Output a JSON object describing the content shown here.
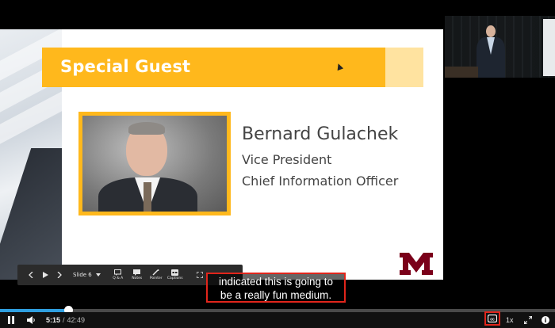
{
  "slide": {
    "banner_title": "Special Guest",
    "guest_name": "Bernard Gulachek",
    "guest_role_1": "Vice President",
    "guest_role_2": "Chief Information Officer",
    "logo_text": "M",
    "accent_color": "#ffb81c",
    "logo_color": "#7a0019"
  },
  "slide_toolbar": {
    "slide_label": "Slide 6",
    "tools": [
      {
        "icon": "qa-icon",
        "label": "Q & A"
      },
      {
        "icon": "notes-icon",
        "label": "Notes"
      },
      {
        "icon": "pointer-icon",
        "label": "Pointer"
      },
      {
        "icon": "captions-icon",
        "label": "Captions"
      }
    ]
  },
  "captions": {
    "line1": "indicated this is going to",
    "line2": "be a really fun medium.",
    "highlight_color": "#e1251b"
  },
  "player": {
    "current_time": "5:15",
    "separator": "/",
    "total_time": "42:49",
    "progress_fraction": 0.1226,
    "speed_label": "1x",
    "progress_color": "#2f9fe0"
  }
}
